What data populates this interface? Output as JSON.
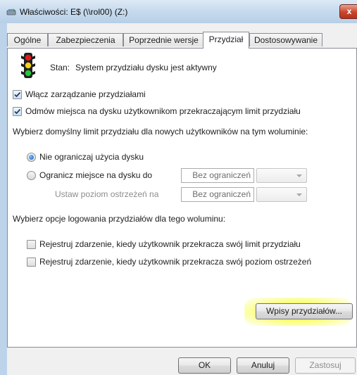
{
  "window": {
    "title": "Właściwości: E$ (\\\\rol00) (Z:)",
    "close_label": "x"
  },
  "tabs": [
    {
      "label": "Ogólne"
    },
    {
      "label": "Zabezpieczenia"
    },
    {
      "label": "Poprzednie wersje"
    },
    {
      "label": "Przydział",
      "active": true
    },
    {
      "label": "Dostosowywanie"
    }
  ],
  "quota": {
    "status_label": "Stan:",
    "status_value": "System przydziału dysku jest aktywny",
    "enable_label": "Włącz zarządzanie przydziałami",
    "enable_checked": true,
    "deny_label": "Odmów miejsca na dysku użytkownikom przekraczającym limit przydziału",
    "deny_checked": true,
    "default_limit_heading": "Wybierz domyślny limit przydziału dla nowych użytkowników na tym woluminie:",
    "no_limit_label": "Nie ograniczaj użycia dysku",
    "limit_label": "Ogranicz miejsce na dysku do",
    "limit_value": "Bez ograniczeń",
    "warning_label": "Ustaw poziom ostrzeżeń na",
    "warning_value": "Bez ograniczeń",
    "selected_option": "no_limit",
    "logging_heading": "Wybierz opcje logowania przydziałów dla tego woluminu:",
    "log_limit_label": "Rejestruj zdarzenie, kiedy użytkownik przekracza swój limit przydziału",
    "log_limit_checked": false,
    "log_warning_label": "Rejestruj zdarzenie, kiedy użytkownik przekracza swój poziom ostrzeżeń",
    "log_warning_checked": false,
    "entries_button": "Wpisy przydziałów..."
  },
  "footer": {
    "ok": "OK",
    "cancel": "Anuluj",
    "apply": "Zastosuj"
  },
  "colors": {
    "highlight": "#f8ff50",
    "traffic_light_red": "#e21b1b",
    "traffic_light_yellow": "#f3d21a",
    "traffic_light_green": "#25c63a"
  }
}
